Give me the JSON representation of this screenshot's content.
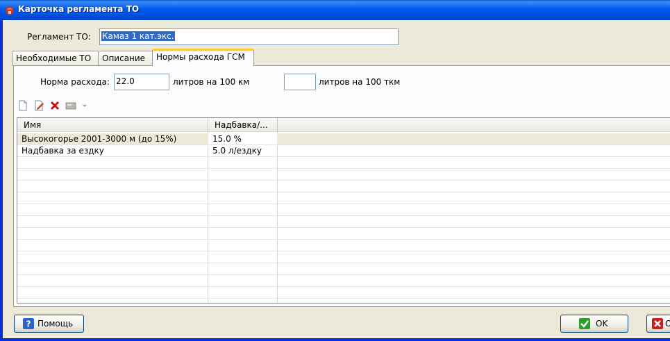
{
  "window": {
    "title": "Карточка регламента ТО"
  },
  "form": {
    "reglament_label": "Регламент ТО:",
    "reglament_value": "Камаз 1 кат.экс."
  },
  "tabs": [
    {
      "label": "Необходимые ТО"
    },
    {
      "label": "Описание"
    },
    {
      "label": "Нормы расхода ГСМ"
    }
  ],
  "norms": {
    "rate_label": "Норма расхода:",
    "rate_value": "22.0",
    "unit_km": "литров на 100 км",
    "tkm_value": "",
    "unit_tkm": "литров на 100 ткм"
  },
  "toolbar": {
    "icons": [
      "new-doc-icon",
      "edit-doc-icon",
      "delete-icon",
      "text-field-icon",
      "dropdown-arrow-icon"
    ]
  },
  "table": {
    "columns": [
      "Имя",
      "Надбавка/..."
    ],
    "rows": [
      {
        "name": "Высокогорье 2001-3000 м (до 15%)",
        "surcharge": "15.0 %"
      },
      {
        "name": "Надбавка за ездку",
        "surcharge": "5.0 л/ездку"
      }
    ]
  },
  "buttons": {
    "help": "Помощь",
    "ok": "OK",
    "cancel": "О"
  },
  "colors": {
    "titlebar": "#0058ee",
    "selection": "#316ac5",
    "active_tab_accent": "#ffc83c"
  }
}
